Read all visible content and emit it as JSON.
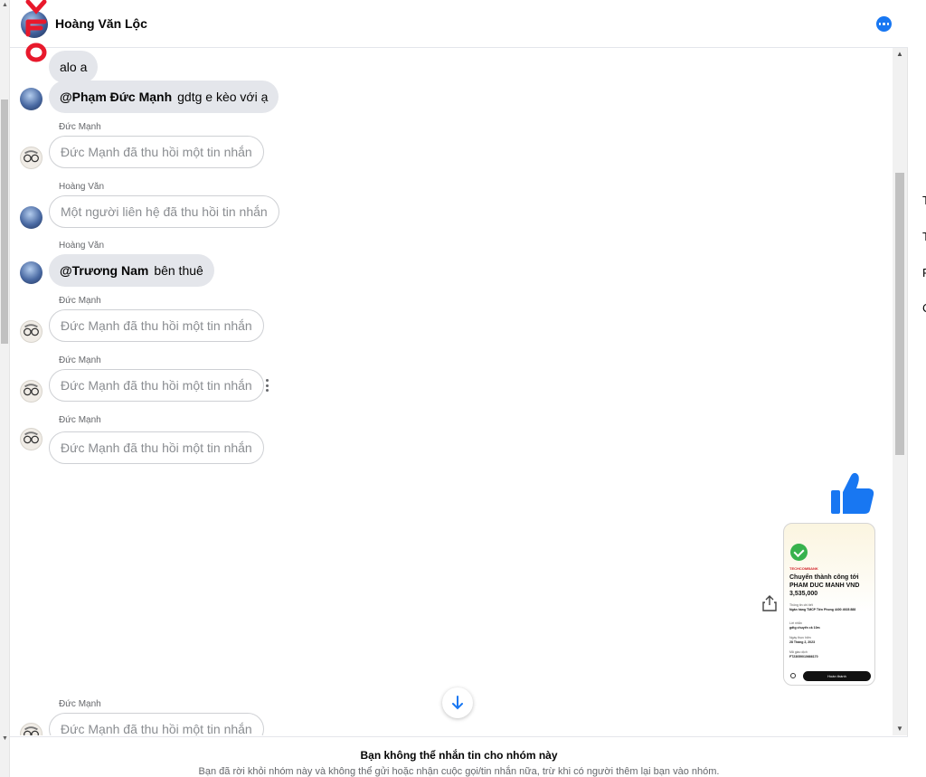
{
  "header": {
    "contact_name": "Hoàng Văn Lộc",
    "more_icon": "ellipsis-circle-icon",
    "accent": "#1877f2"
  },
  "messages": [
    {
      "sender": "",
      "text": "alo a"
    },
    {
      "sender": "",
      "mention": "@Phạm Đức Mạnh",
      "text": "gdtg e kèo với ạ"
    },
    {
      "sender": "Đức Mạnh",
      "text": "Đức Mạnh đã thu hồi một tin nhắn"
    },
    {
      "sender": "Hoàng Văn",
      "text": "Một người liên hệ đã thu hồi tin nhắn"
    },
    {
      "sender": "Hoàng Văn",
      "mention": "@Trương Nam",
      "text": "bên thuê"
    },
    {
      "sender": "Đức Mạnh",
      "text": "Đức Mạnh đã thu hồi một tin nhắn"
    },
    {
      "sender": "Đức Mạnh",
      "text": "Đức Mạnh đã thu hồi một tin nhắn"
    },
    {
      "sender": "Đức Mạnh",
      "text": "Đức Mạnh đã thu hồi một tin nhắn"
    },
    {
      "sender": "Đức Mạnh",
      "text": "Đức Mạnh đã thu hồi một tin nhắn"
    }
  ],
  "receipt": {
    "bank_logo": "TECHCOMBANK",
    "title": "Chuyển thành công tới PHAM DUC MANH VND 3,535,000",
    "rows": [
      {
        "label": "Thông tin chi tiết",
        "value": "Ngân hàng TMCP Tiên Phong 4400 4928 888"
      },
      {
        "label": "Lời nhắn",
        "value": "gdtg chuyển ck 10m"
      },
      {
        "label": "Ngày thực hiện",
        "value": "28 Tháng 2, 2023"
      },
      {
        "label": "Mã giao dịch",
        "value": "FT23059010666170"
      }
    ],
    "button": "Hoàn thành"
  },
  "icons": {
    "like": "thumbs-up-icon",
    "share": "share-icon",
    "jump": "arrow-down-icon"
  },
  "footer": {
    "title": "Bạn không thể nhắn tin cho nhóm này",
    "subtitle": "Bạn đã rời khỏi nhóm này và không thể gửi hoặc nhận cuộc gọi/tin nhắn nữa, trừ khi có người thêm lại bạn vào nhóm."
  },
  "right_column": [
    "T",
    "T",
    "F",
    "C"
  ],
  "watermark": "VFO"
}
